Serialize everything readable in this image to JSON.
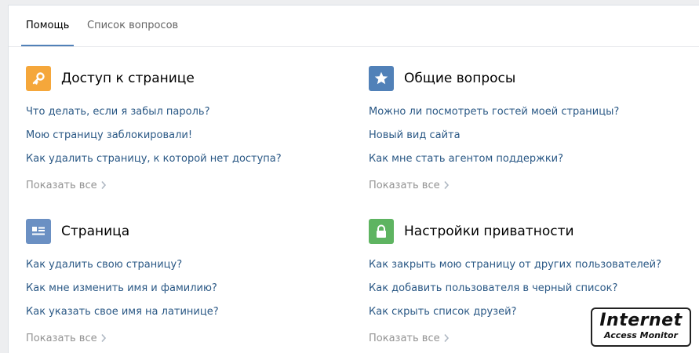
{
  "tabs": [
    {
      "label": "Помощь",
      "active": true
    },
    {
      "label": "Список вопросов",
      "active": false
    }
  ],
  "sections": [
    {
      "title": "Доступ к странице",
      "icon": "key-icon",
      "color": "#f5a73b",
      "links": [
        "Что делать, если я забыл пароль?",
        "Мою страницу заблокировали!",
        "Как удалить страницу, к которой нет доступа?"
      ],
      "show_all": "Показать все"
    },
    {
      "title": "Общие вопросы",
      "icon": "star-icon",
      "color": "#5181b8",
      "links": [
        "Можно ли посмотреть гостей моей страницы?",
        "Новый вид сайта",
        "Как мне стать агентом поддержки?"
      ],
      "show_all": "Показать все"
    },
    {
      "title": "Страница",
      "icon": "profile-icon",
      "color": "#6b90c3",
      "links": [
        "Как удалить свою страницу?",
        "Как мне изменить имя и фамилию?",
        "Как указать свое имя на латинице?"
      ],
      "show_all": "Показать все"
    },
    {
      "title": "Настройки приватности",
      "icon": "lock-icon",
      "color": "#5eb461",
      "links": [
        "Как закрыть мою страницу от других пользователей?",
        "Как добавить пользователя в черный список?",
        "Как скрыть список друзей?"
      ],
      "show_all": "Показать все"
    }
  ],
  "watermark": {
    "main": "Internet",
    "sub": "Access Monitor"
  }
}
